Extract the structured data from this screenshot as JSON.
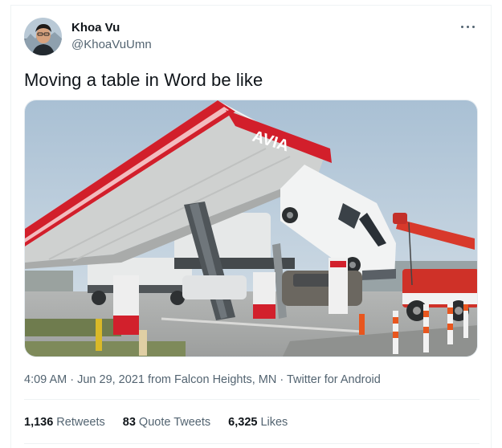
{
  "tweet": {
    "author": {
      "display_name": "Khoa Vu",
      "handle": "@KhoaVuUmn"
    },
    "more_icon": "more-horizontal-icon",
    "text": "Moving a table in Word be like",
    "media": {
      "sign_text": "AVIA"
    },
    "meta": {
      "time": "4:09 AM",
      "sep1": " · ",
      "date": "Jun 29, 2021",
      "from_label": " from ",
      "location": "Falcon Heights, MN",
      "sep2": " · ",
      "source": "Twitter for Android"
    },
    "stats": [
      {
        "count": "1,136",
        "label": "Retweets"
      },
      {
        "count": "83",
        "label": "Quote Tweets"
      },
      {
        "count": "6,325",
        "label": "Likes"
      }
    ]
  },
  "colors": {
    "primary_text": "#0f1419",
    "secondary_text": "#536471",
    "border": "#eff3f4"
  }
}
